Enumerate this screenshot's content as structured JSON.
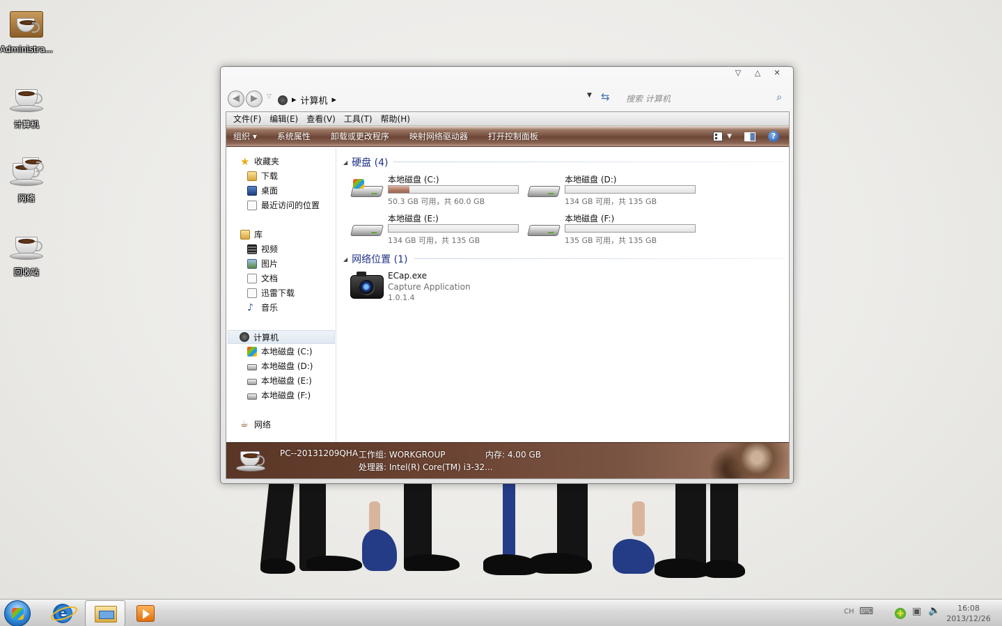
{
  "desktop": {
    "icons": [
      {
        "label": "Administra...",
        "icon": "user-folder-icon"
      },
      {
        "label": "计算机",
        "icon": "computer-icon"
      },
      {
        "label": "网络",
        "icon": "network-icon"
      },
      {
        "label": "回收站",
        "icon": "recycle-bin-icon"
      }
    ]
  },
  "window": {
    "caption_buttons": {
      "minimize": "▽",
      "maximize": "△",
      "close": "✕"
    },
    "address": {
      "back": "◀",
      "forward": "▶",
      "path": [
        "计算机"
      ],
      "separator": "▸",
      "search_placeholder": "搜索 计算机"
    },
    "menu": [
      "文件(F)",
      "编辑(E)",
      "查看(V)",
      "工具(T)",
      "帮助(H)"
    ],
    "toolbar": {
      "organize": "组织 ▾",
      "items": [
        "系统属性",
        "卸载或更改程序",
        "映射网络驱动器",
        "打开控制面板"
      ],
      "help": "?"
    },
    "nav": {
      "favorites": {
        "label": "收藏夹",
        "items": [
          "下载",
          "桌面",
          "最近访问的位置"
        ]
      },
      "libraries": {
        "label": "库",
        "items": [
          "视频",
          "图片",
          "文档",
          "迅雷下载",
          "音乐"
        ]
      },
      "computer": {
        "label": "计算机",
        "items": [
          "本地磁盘 (C:)",
          "本地磁盘 (D:)",
          "本地磁盘 (E:)",
          "本地磁盘 (F:)"
        ]
      },
      "network": {
        "label": "网络"
      }
    },
    "groups": {
      "hard_disks": {
        "title": "硬盘 (4)",
        "drives": [
          {
            "name": "本地磁盘 (C:)",
            "free": "50.3 GB 可用，共 60.0 GB",
            "used_fraction": 0.16,
            "system": true
          },
          {
            "name": "本地磁盘 (D:)",
            "free": "134 GB 可用，共 135 GB",
            "used_fraction": 0.0,
            "system": false
          },
          {
            "name": "本地磁盘 (E:)",
            "free": "134 GB 可用，共 135 GB",
            "used_fraction": 0.0,
            "system": false
          },
          {
            "name": "本地磁盘 (F:)",
            "free": "135 GB 可用，共 135 GB",
            "used_fraction": 0.0,
            "system": false
          }
        ]
      },
      "network_locations": {
        "title": "网络位置 (1)",
        "item": {
          "name": "ECap.exe",
          "description": "Capture Application",
          "version": "1.0.1.4"
        }
      }
    },
    "details": {
      "computer_name": "PC--20131209QHA",
      "workgroup": "工作组: WORKGROUP",
      "memory": "内存: 4.00 GB",
      "processor": "处理器: Intel(R) Core(TM) i3-32..."
    }
  },
  "taskbar": {
    "language": "CH",
    "clock_time": "16:08",
    "clock_date": "2013/12/26"
  }
}
